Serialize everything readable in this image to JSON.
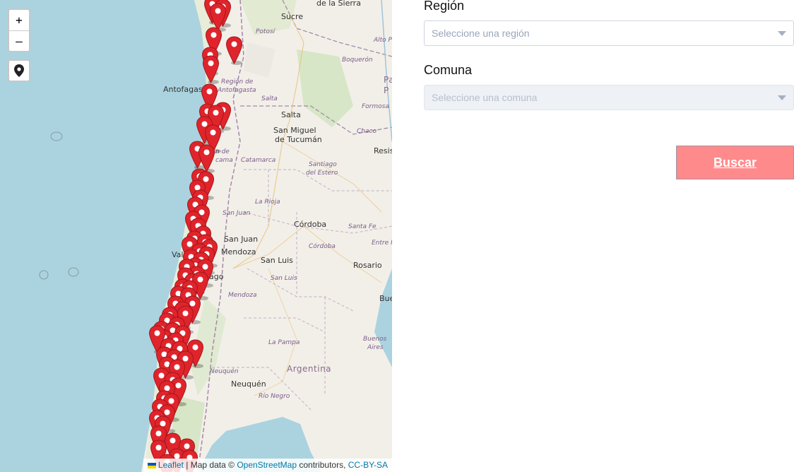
{
  "map": {
    "zoom_in": "+",
    "zoom_out": "–",
    "locate_icon": "map-pin-icon",
    "labels": {
      "sucre": "Sucre",
      "de_la_sierra": "de la Sierra",
      "potosi": "Potosí",
      "alto_p": "Alto P",
      "boqueron": "Boquerón",
      "antofagasta": "Antofagasta",
      "region_antofagasta_1": "Región de",
      "region_antofagasta_2": "Antofagasta",
      "pa_1": "Pa",
      "pa_2": "P",
      "salta": "Salta",
      "salta_region": "Salta",
      "formosa": "Formosa",
      "chaco": "Chaco",
      "san_miguel_1": "San Miguel",
      "san_miguel_2": "de Tucumán",
      "resis": "Resis",
      "atacama_1": "n de",
      "atacama_2": "cama",
      "catamarca": "Catamarca",
      "santiago_1": "Santiago",
      "santiago_2": "del Estero",
      "la_rioja": "La Rioja",
      "san_juan_region": "San Juan",
      "cordoba_city": "Córdoba",
      "santa_fe": "Santa Fe",
      "san_juan_city": "San Juan",
      "entre_r": "Entre R",
      "cordoba_region": "Córdoba",
      "mendoza_city": "Mendoza",
      "san_luis_city": "San Luis",
      "val": "Val",
      "rosario": "Rosario",
      "ago": "ago",
      "san_luis_region": "San Luis",
      "mendoza_region": "Mendoza",
      "bue": "Bue",
      "la_pampa": "La Pampa",
      "buenos_aires_1": "Buenos",
      "buenos_aires_2": "Aires",
      "neuquen_region": "Neuquén",
      "argentina": "Argentina",
      "neuquen_city": "Neuquén",
      "rio_negro": "Río Negro"
    },
    "attribution": {
      "leaflet": "Leaflet",
      "separator": "|",
      "map_data": "Map data ©",
      "osm": "OpenStreetMap",
      "contributors": "contributors,",
      "license": "CC-BY-SA"
    },
    "marker_color": "#e0242b"
  },
  "form": {
    "region_label": "Región",
    "region_placeholder": "Seleccione una región",
    "comuna_label": "Comuna",
    "comuna_placeholder": "Seleccione una comuna",
    "search_button": "Buscar",
    "button_color": "#ff8a8c"
  }
}
